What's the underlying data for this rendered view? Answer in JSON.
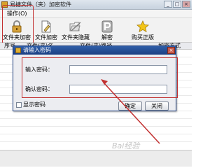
{
  "window": {
    "title": "易捷文件（夹）加密软件",
    "min_glyph": "_",
    "max_glyph": "□",
    "close_glyph": "×"
  },
  "menu": {
    "items": [
      {
        "label": "操作(O)"
      }
    ]
  },
  "toolbar": {
    "buttons": [
      {
        "label": "文件夹加密",
        "icon": "lock-icon"
      },
      {
        "label": "文件加密",
        "icon": "file-pencil-icon"
      },
      {
        "label": "文件夹隐藏",
        "icon": "folder-hide-icon"
      },
      {
        "label": "解密",
        "icon": "decrypt-p-icon"
      },
      {
        "label": "购买正版",
        "icon": "star-icon"
      }
    ]
  },
  "list": {
    "columns": [
      "序号",
      "文件(夹)名",
      "文件(夹)路径",
      "加密方式"
    ]
  },
  "dialog": {
    "title": "请输入密码",
    "close_glyph": "×",
    "password_label": "输入密码：",
    "password_value": "",
    "confirm_label": "确认密码：",
    "confirm_value": "",
    "show_password_label": "显示密码",
    "show_password_checked": false,
    "ok_label": "确定",
    "close_label": "关闭"
  },
  "watermark": "Bai经验",
  "colors": {
    "annotation_red": "#c23030",
    "dialog_title_bar": "#2f5ea8"
  }
}
